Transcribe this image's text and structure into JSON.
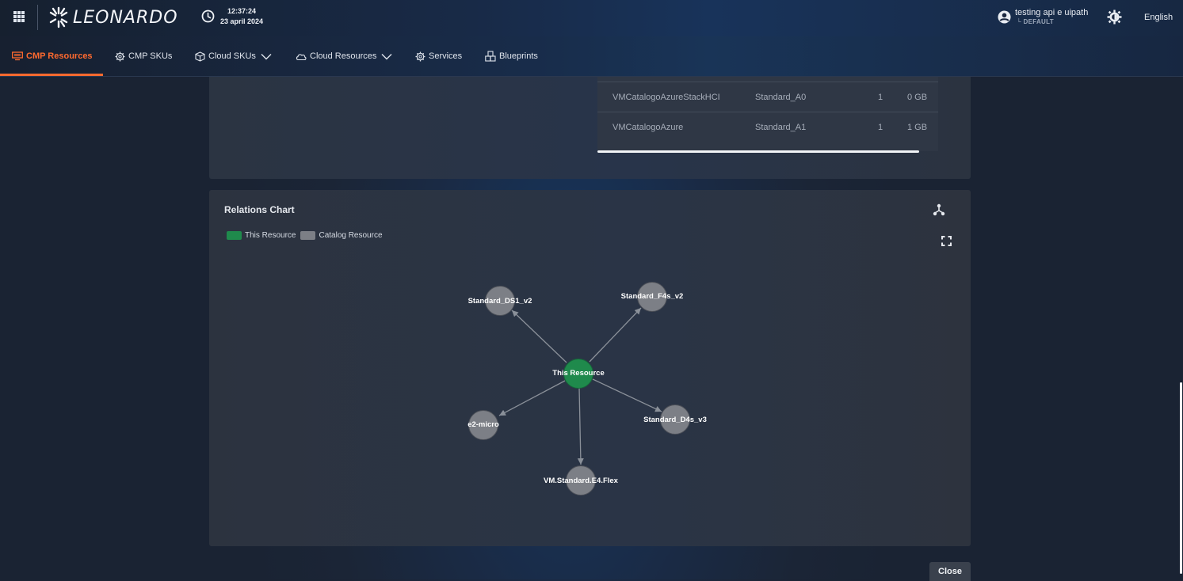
{
  "header": {
    "brand": "LEONARDO",
    "time": "12:37:24",
    "date": "23 april 2024",
    "user_name": "testing api e uipath",
    "tenant": "└ DEFAULT",
    "language": "English"
  },
  "nav": {
    "tabs": [
      {
        "label": "CMP Resources",
        "icon": "server-icon",
        "active": true
      },
      {
        "label": "CMP SKUs",
        "icon": "gear-icon"
      },
      {
        "label": "Cloud SKUs",
        "icon": "box-icon",
        "dropdown": true
      },
      {
        "label": "Cloud Resources",
        "icon": "cloud-icon",
        "dropdown": true
      },
      {
        "label": "Services",
        "icon": "gear-icon"
      },
      {
        "label": "Blueprints",
        "icon": "blueprint-icon"
      }
    ]
  },
  "vm_table": {
    "rows": [
      {
        "name": "VMCatalogoAzureStackHCI",
        "size": "Standard_A0",
        "cpu": "1",
        "memory": "0 GB"
      },
      {
        "name": "VMCatalogoAzure",
        "size": "Standard_A1",
        "cpu": "1",
        "memory": "1 GB"
      }
    ]
  },
  "relations": {
    "title": "Relations Chart",
    "legend": [
      {
        "label": "This Resource",
        "color": "#1f8a4c"
      },
      {
        "label": "Catalog Resource",
        "color": "#7c7f86"
      }
    ],
    "center": "This Resource",
    "nodes": [
      "Standard_DS1_v2",
      "Standard_F4s_v2",
      "e2-micro",
      "Standard_D4s_v3",
      "VM.Standard.E4.Flex"
    ]
  },
  "footer": {
    "close_label": "Close"
  },
  "colors": {
    "accent": "#ff6a2f",
    "this_resource": "#1f8a4c",
    "catalog_resource": "#7c7f86"
  }
}
